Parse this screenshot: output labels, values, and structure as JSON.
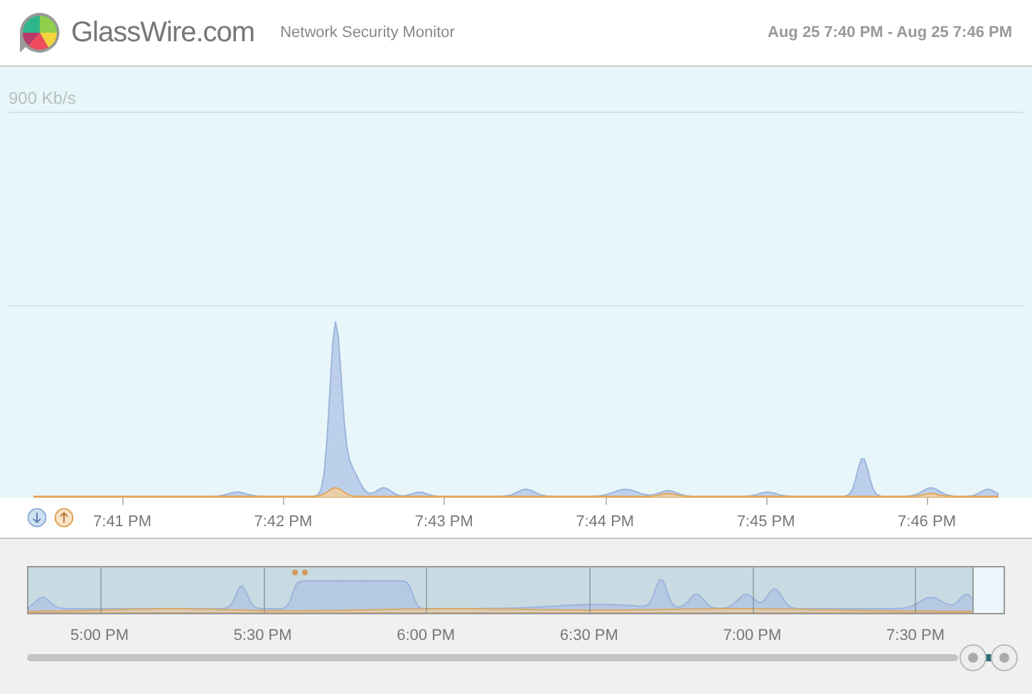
{
  "header": {
    "logo_text": "GlassWire.com",
    "subtitle": "Network Security Monitor",
    "time_range": "Aug 25 7:40 PM - Aug 25 7:46 PM"
  },
  "graph": {
    "scale_label": "900 Kb/s",
    "time_ticks": [
      "7:41 PM",
      "7:42 PM",
      "7:43 PM",
      "7:44 PM",
      "7:45 PM",
      "7:46 PM"
    ]
  },
  "overview": {
    "time_ticks": [
      "5:00 PM",
      "5:30 PM",
      "6:00 PM",
      "6:30 PM",
      "7:00 PM",
      "7:30 PM"
    ]
  }
}
